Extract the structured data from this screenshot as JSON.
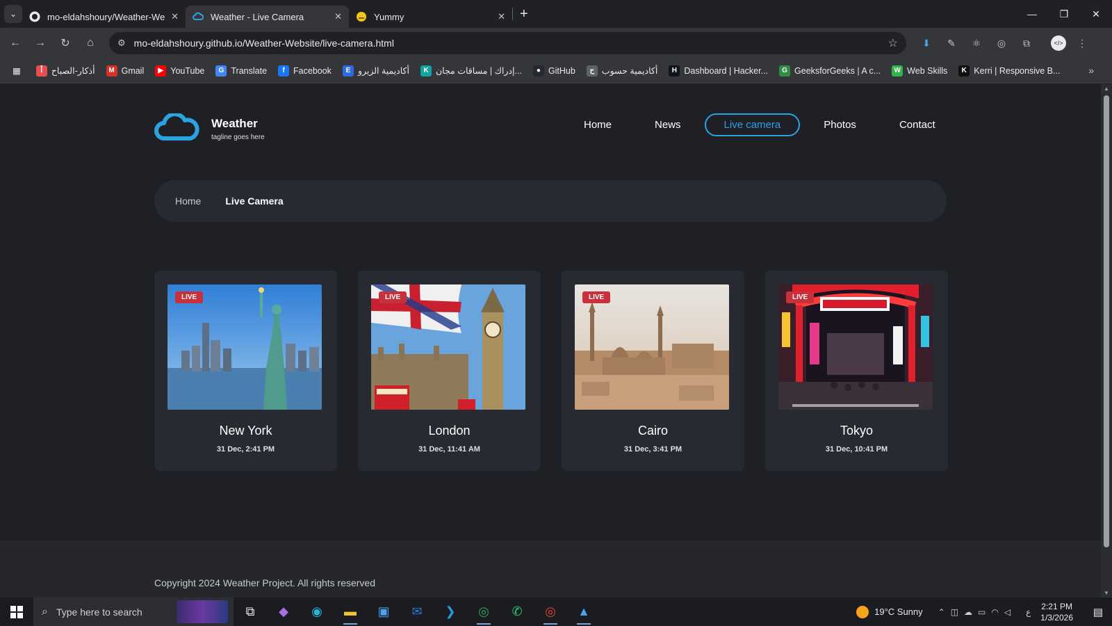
{
  "browser": {
    "tabs": [
      {
        "title": "mo-eldahshoury/Weather-Web",
        "icon": "github-icon",
        "active": false
      },
      {
        "title": "Weather - Live Camera",
        "icon": "cloud-icon",
        "active": true
      },
      {
        "title": "Yummy",
        "icon": "yummy-icon",
        "active": false
      }
    ],
    "url": "mo-eldahshoury.github.io/Weather-Website/live-camera.html",
    "bookmarks": [
      {
        "label": "أذكار-الصباح",
        "color": "#e84e4e",
        "glyph": "أ"
      },
      {
        "label": "Gmail",
        "color": "#d93025",
        "glyph": "M"
      },
      {
        "label": "YouTube",
        "color": "#ff0000",
        "glyph": "▶"
      },
      {
        "label": "Translate",
        "color": "#4285f4",
        "glyph": "G"
      },
      {
        "label": "Facebook",
        "color": "#1877f2",
        "glyph": "f"
      },
      {
        "label": "أكاديمية الزيرو",
        "color": "#2d6cdf",
        "glyph": "E"
      },
      {
        "label": "إدراك | مساقات مجان...",
        "color": "#14a3a3",
        "glyph": "K"
      },
      {
        "label": "GitHub",
        "color": "#24292f",
        "glyph": "●"
      },
      {
        "label": "أكاديمية حسوب",
        "color": "#5f6368",
        "glyph": "ح"
      },
      {
        "label": "Dashboard | Hacker...",
        "color": "#0e141e",
        "glyph": "H"
      },
      {
        "label": "GeeksforGeeks | A c...",
        "color": "#2f8d46",
        "glyph": "G"
      },
      {
        "label": "Web Skills",
        "color": "#2fb34a",
        "glyph": "W"
      },
      {
        "label": "Kerri | Responsive B...",
        "color": "#111111",
        "glyph": "K"
      }
    ]
  },
  "site": {
    "logo_title": "Weather",
    "logo_tagline": "tagline goes here",
    "nav": [
      {
        "label": "Home",
        "active": false
      },
      {
        "label": "News",
        "active": false
      },
      {
        "label": "Live camera",
        "active": true
      },
      {
        "label": "Photos",
        "active": false
      },
      {
        "label": "Contact",
        "active": false
      }
    ],
    "breadcrumb": {
      "home": "Home",
      "current": "Live Camera"
    },
    "live_label": "LIVE",
    "cameras": [
      {
        "city": "New York",
        "time": "31 Dec, 2:41 PM",
        "scene": "new-york"
      },
      {
        "city": "London",
        "time": "31 Dec, 11:41 AM",
        "scene": "london"
      },
      {
        "city": "Cairo",
        "time": "31 Dec, 3:41 PM",
        "scene": "cairo"
      },
      {
        "city": "Tokyo",
        "time": "31 Dec, 10:41 PM",
        "scene": "tokyo"
      }
    ],
    "copyright": "Copyright 2024 Weather Project. All rights reserved"
  },
  "taskbar": {
    "search_placeholder": "Type here to search",
    "weather": "19°C  Sunny",
    "time": "2:21 PM",
    "date": "1/3/2026",
    "language": "ع"
  },
  "colors": {
    "accent": "#2aa3e0",
    "page_bg": "#1e2026",
    "card_bg": "#272a31",
    "live_badge": "#c8313b"
  }
}
